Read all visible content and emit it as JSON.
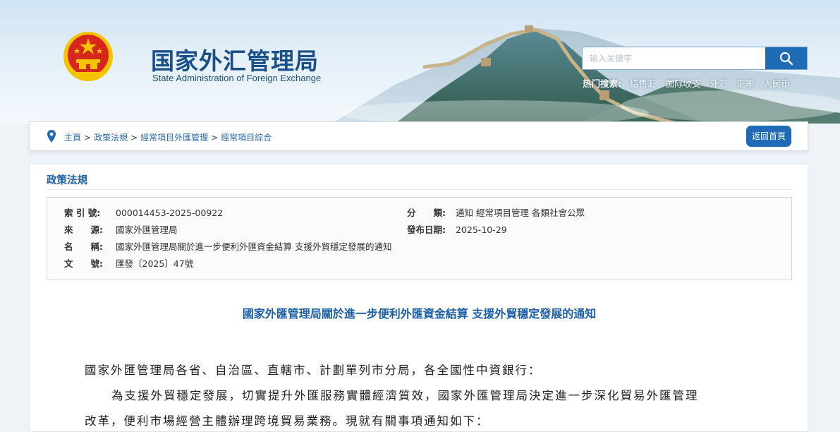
{
  "header": {
    "title_cn": "国家外汇管理局",
    "title_en": "State Administration of Foreign Exchange"
  },
  "search": {
    "placeholder": "输入关键字",
    "icon": "search-icon",
    "hot_label": "热门搜索:",
    "hot_links": [
      "结售汇",
      "国际收支",
      "外汇",
      "汇率",
      "人民币"
    ]
  },
  "breadcrumb": {
    "items": [
      "主頁",
      "政策法規",
      "經常項目外匯管理",
      "經常項目綜合"
    ],
    "separator": ">",
    "home_button": "返回首頁"
  },
  "section": {
    "title": "政策法規"
  },
  "meta": {
    "index_label": "索 引 號:",
    "index_value": "000014453-2025-00922",
    "category_label": "分　　類:",
    "category_value": "通知  經常項目管理  各類社會公眾",
    "source_label": "來　　源:",
    "source_value": "國家外匯管理局",
    "date_label": "發布日期:",
    "date_value": "2025-10-29",
    "name_label": "名　　稱:",
    "name_value": "國家外匯管理局關於進一步便利外匯資金結算 支援外貿穩定發展的通知",
    "docno_label": "文　　號:",
    "docno_value": "匯發〔2025〕47號"
  },
  "document": {
    "title": "國家外匯管理局關於進一步便利外匯資金結算 支援外貿穩定發展的通知",
    "salutation": "國家外匯管理局各省、自治區、直轄市、計劃單列市分局，各全國性中資銀行：",
    "para1_line1": "為支援外貿穩定發展，切實提升外匯服務實體經濟質效，國家外匯管理局決定進一步深化貿易外匯管理",
    "para1_line2": "改革，便利市場經營主體辦理跨境貿易業務。現就有關事項通知如下："
  },
  "colors": {
    "brand_blue": "#1b5fa8",
    "button_blue": "#1f6bb5",
    "emblem_red": "#d7261b",
    "emblem_gold": "#f5c400"
  }
}
